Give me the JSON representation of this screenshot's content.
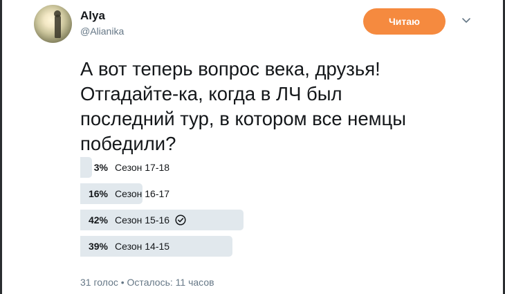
{
  "user": {
    "display_name": "Alya",
    "handle": "@Alianika"
  },
  "follow_button": {
    "label": "Читаю",
    "color": "#f58a3f"
  },
  "tweet": {
    "lines": [
      "А вот теперь вопрос века, друзья!",
      "Отгадайте-ка, когда в ЛЧ был",
      "последний тур, в котором все немцы",
      "победили?"
    ]
  },
  "poll": {
    "options": [
      {
        "percent_label": "3%",
        "percent": 3,
        "label": "Сезон 17-18",
        "voted": false
      },
      {
        "percent_label": "16%",
        "percent": 16,
        "label": "Сезон 16-17",
        "voted": false
      },
      {
        "percent_label": "42%",
        "percent": 42,
        "label": "Сезон 15-16",
        "voted": true
      },
      {
        "percent_label": "39%",
        "percent": 39,
        "label": "Сезон 14-15",
        "voted": false
      }
    ],
    "votes": "31 голос",
    "separator": "•",
    "time_left": "Осталось: 11 часов"
  },
  "icons": {
    "avatar": "profile-photo",
    "more": "chevron-down-icon",
    "voted": "check-circle-icon"
  },
  "colors": {
    "bar": "#e1e8ed",
    "muted_text": "#657786"
  }
}
